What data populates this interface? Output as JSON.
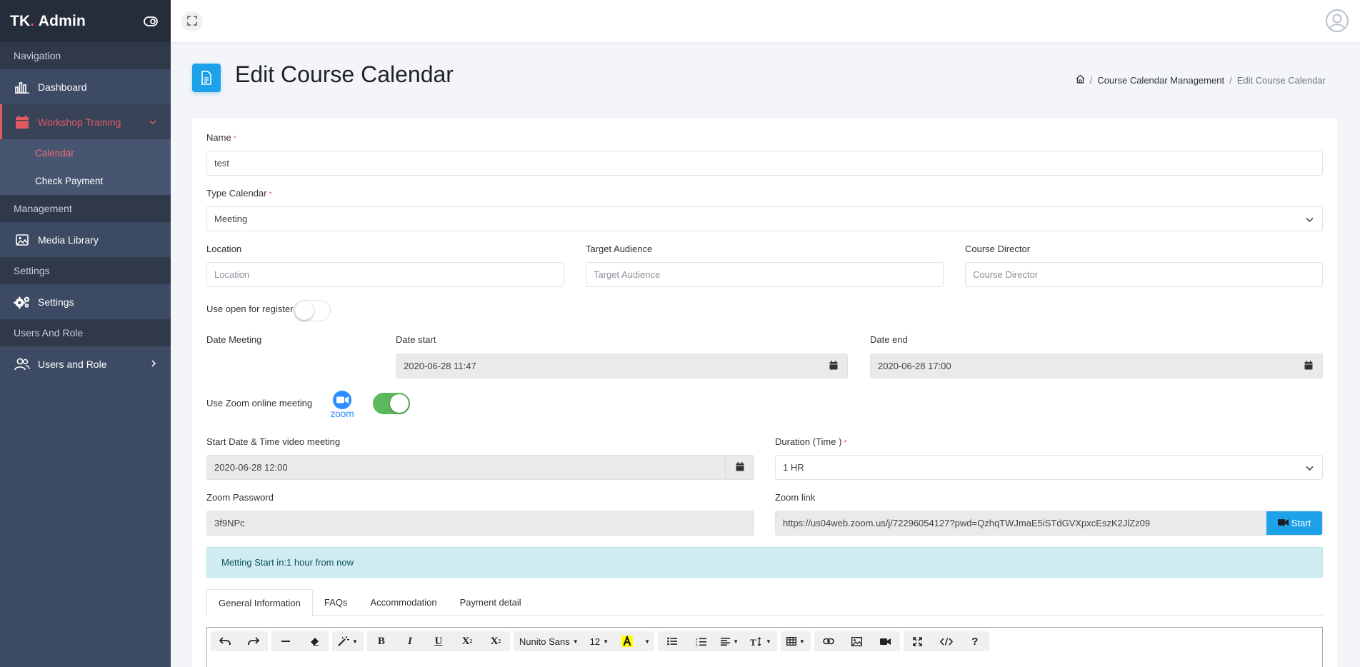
{
  "sidebar": {
    "brand": {
      "prefix": "TK",
      "dot": ".",
      "name": " Admin"
    },
    "sections": {
      "navigation": "Navigation",
      "management": "Management",
      "settings": "Settings",
      "users": "Users And Role"
    },
    "items": {
      "dashboard": "Dashboard",
      "workshop": "Workshop Training",
      "calendar": "Calendar",
      "check_payment": "Check Payment",
      "media_library": "Media Library",
      "settings": "Settings",
      "users_role": "Users and Role"
    },
    "accent": "#e05a62"
  },
  "header": {
    "title": "Edit Course Calendar",
    "breadcrumb": [
      "Course Calendar Management",
      "Edit Course Calendar"
    ]
  },
  "form": {
    "name": {
      "label": "Name",
      "value": "test"
    },
    "type_calendar": {
      "label": "Type Calendar",
      "value": "Meeting"
    },
    "location": {
      "label": "Location",
      "placeholder": "Location"
    },
    "target_audience": {
      "label": "Target Audience",
      "placeholder": "Target Audience"
    },
    "course_director": {
      "label": "Course Director",
      "placeholder": "Course Director"
    },
    "open_register": {
      "label": "Use open for register",
      "enabled": false
    },
    "date_meeting": {
      "label": "Date Meeting"
    },
    "date_start": {
      "label": "Date start",
      "value": "2020-06-28 11:47"
    },
    "date_end": {
      "label": "Date end",
      "value": "2020-06-28 17:00"
    },
    "zoom_toggle": {
      "label": "Use Zoom online meeting",
      "enabled": true,
      "logo_text": "zoom"
    },
    "start_video": {
      "label": "Start Date & Time video meeting",
      "value": "2020-06-28 12:00"
    },
    "duration": {
      "label": "Duration (Time )",
      "value": "1 HR"
    },
    "zoom_password": {
      "label": "Zoom Password",
      "value": "3f9NPc"
    },
    "zoom_link": {
      "label": "Zoom link",
      "value": "https://us04web.zoom.us/j/72296054127?pwd=QzhqTWJmaE5iSTdGVXpxcEszK2JlZz09",
      "button": "Start"
    },
    "alert": "Metting Start in:1 hour from now",
    "required_mark": "*"
  },
  "tabs": [
    "General Information",
    "FAQs",
    "Accommodation",
    "Payment detail"
  ],
  "editor": {
    "font_name": "Nunito Sans",
    "font_size": "12"
  }
}
